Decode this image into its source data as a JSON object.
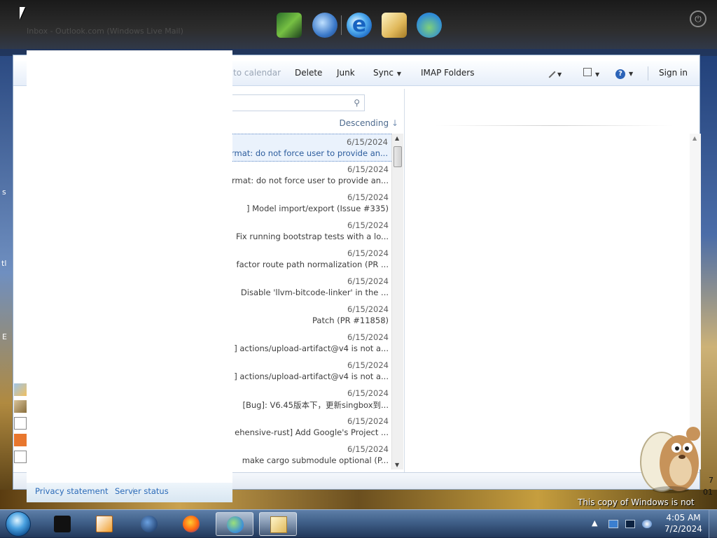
{
  "launcher": {
    "ghost_title": "Inbox - Outlook.com (Windows Live Mail)",
    "icons": [
      "minecraft-icon",
      "globe-download-icon",
      "internet-explorer-icon",
      "mail-icon",
      "messenger-icon"
    ],
    "ie_glyph": "e",
    "power_glyph": "⏻"
  },
  "desktop": {
    "left_chars": [
      "s",
      "tl",
      "E"
    ],
    "right_chars": [
      "7",
      "01"
    ]
  },
  "toolbar": {
    "add_to_calendar": "to calendar",
    "delete": "Delete",
    "junk": "Junk",
    "sync": "Sync",
    "imap_folders": "IMAP Folders",
    "sign_in": "Sign in",
    "caret": "▼"
  },
  "search": {
    "icon": "⚲"
  },
  "sort": {
    "label": "Descending",
    "arrow": "↓"
  },
  "messages": [
    {
      "date": "6/15/2024",
      "subject": "rmat: do not force user to provide an..."
    },
    {
      "date": "6/15/2024",
      "subject": "rmat: do not force user to provide an..."
    },
    {
      "date": "6/15/2024",
      "subject": "] Model import/export (Issue #335)"
    },
    {
      "date": "6/15/2024",
      "subject": "Fix running bootstrap tests with a lo..."
    },
    {
      "date": "6/15/2024",
      "subject": "factor route path normalization (PR ..."
    },
    {
      "date": "6/15/2024",
      "subject": "Disable 'llvm-bitcode-linker' in the ..."
    },
    {
      "date": "6/15/2024",
      "subject": "Patch (PR #11858)"
    },
    {
      "date": "6/15/2024",
      "subject": "] actions/upload-artifact@v4 is not a..."
    },
    {
      "date": "6/15/2024",
      "subject": "] actions/upload-artifact@v4 is not a..."
    },
    {
      "date": "6/15/2024",
      "subject": "[Bug]: V6.45版本下，更新singbox到..."
    },
    {
      "date": "6/15/2024",
      "subject": "ehensive-rust] Add Google's Project ..."
    },
    {
      "date": "6/15/2024",
      "subject": "make cargo submodule optional (P..."
    }
  ],
  "footer": {
    "privacy": "Privacy statement",
    "server_status": "Server status"
  },
  "watermark": "This copy of Windows is not genuine",
  "tray": {
    "arrow": "▲",
    "time": "4:05 AM",
    "date": "7/2/2024"
  },
  "colors": {
    "accent": "#2a6ab8",
    "selection": "#eaf2fc",
    "toolbar_bg": "#e6eef9"
  }
}
